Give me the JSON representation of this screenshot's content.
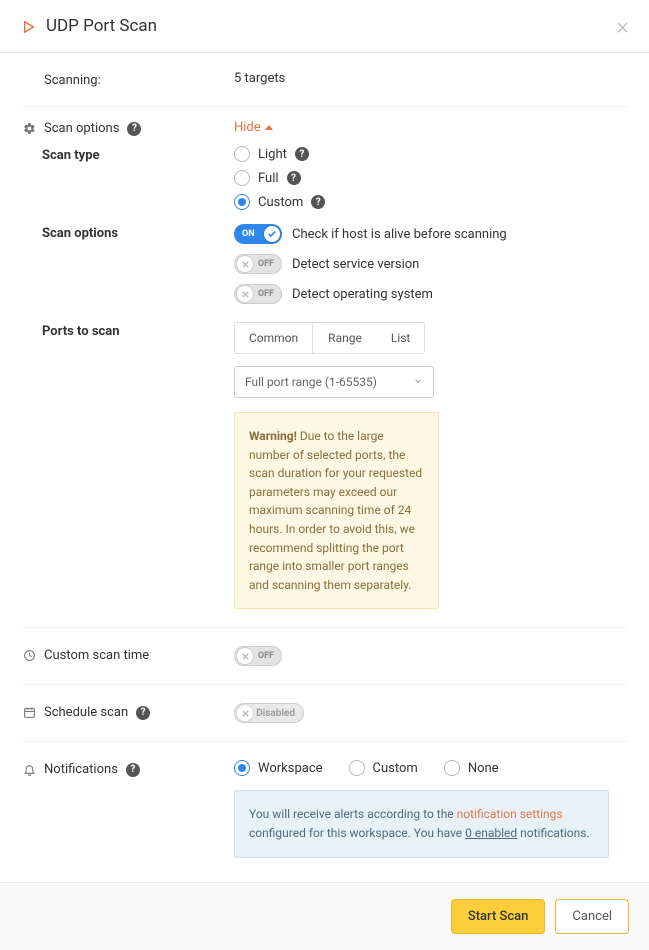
{
  "header": {
    "title": "UDP Port Scan"
  },
  "scanning": {
    "label": "Scanning:",
    "value": "5 targets"
  },
  "scanOptions": {
    "label": "Scan options",
    "hideLabel": "Hide",
    "scanType": {
      "label": "Scan type",
      "options": {
        "light": "Light",
        "full": "Full",
        "custom": "Custom"
      },
      "selected": "custom"
    },
    "options": {
      "label": "Scan options",
      "checkAlive": {
        "state": "ON",
        "label": "Check if host is alive before scanning"
      },
      "detectService": {
        "state": "OFF",
        "label": "Detect service version"
      },
      "detectOS": {
        "state": "OFF",
        "label": "Detect operating system"
      }
    },
    "ports": {
      "label": "Ports to scan",
      "tabs": {
        "common": "Common",
        "range": "Range",
        "list": "List",
        "active": "common"
      },
      "selectValue": "Full port range (1-65535)",
      "warning": {
        "bold": "Warning!",
        "text": " Due to the large number of selected ports, the scan duration for your requested parameters may exceed our maximum scanning time of 24 hours. In order to avoid this, we recommend splitting the port range into smaller port ranges and scanning them separately."
      }
    }
  },
  "customScanTime": {
    "label": "Custom scan time",
    "toggleState": "OFF"
  },
  "scheduleScan": {
    "label": "Schedule scan",
    "toggleState": "Disabled"
  },
  "notifications": {
    "label": "Notifications",
    "options": {
      "workspace": "Workspace",
      "custom": "Custom",
      "none": "None"
    },
    "selected": "workspace",
    "info": {
      "prefix": "You will receive alerts according to the ",
      "link": "notification settings",
      "mid": " configured for this workspace. You have ",
      "countLabel": "0 enabled",
      "suffix": " notifications."
    }
  },
  "footer": {
    "start": "Start Scan",
    "cancel": "Cancel"
  }
}
